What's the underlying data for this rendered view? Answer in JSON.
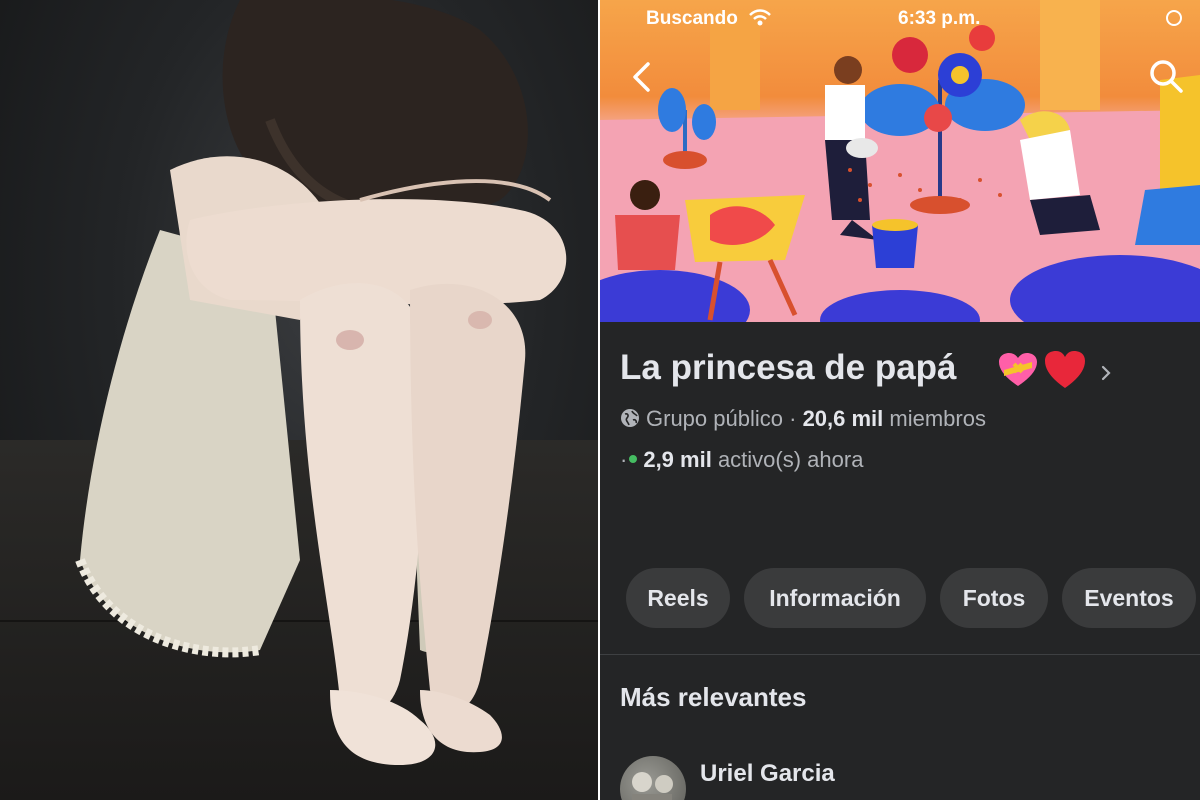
{
  "status_bar": {
    "carrier": "Buscando",
    "time": "6:33 p.m."
  },
  "group": {
    "name": "La princesa de papá",
    "privacy": "Grupo público",
    "separator": "·",
    "members_count": "20,6 mil",
    "members_label": "miembros",
    "active_count": "2,9 mil",
    "active_label": "activo(s) ahora"
  },
  "tabs": [
    {
      "label": "Reels"
    },
    {
      "label": "Información"
    },
    {
      "label": "Fotos"
    },
    {
      "label": "Eventos"
    }
  ],
  "feed": {
    "section_title": "Más relevantes",
    "first_post_author": "Uriel Garcia"
  },
  "icons": {
    "back": "chevron-left-icon",
    "search": "search-icon",
    "wifi": "wifi-icon",
    "globe": "globe-icon",
    "title_chevron": "chevron-right-icon"
  },
  "colors": {
    "app_background": "#242526",
    "tab_background": "#3a3b3c",
    "active_dot": "#45bd62",
    "primary_text": "#e4e6eb",
    "secondary_text": "#b0b3b8"
  }
}
